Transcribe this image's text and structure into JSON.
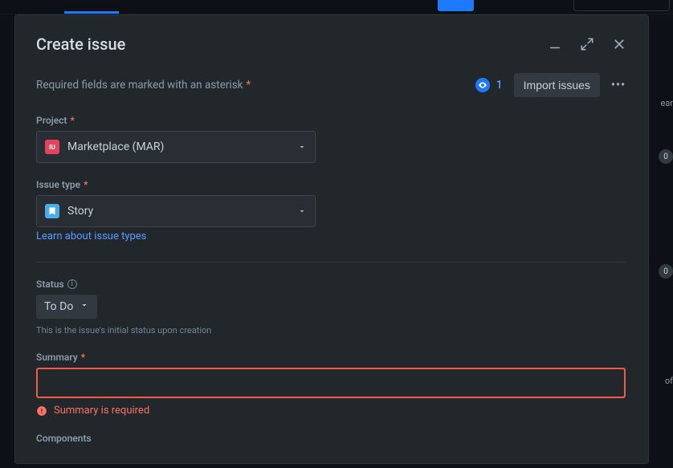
{
  "title": "Create issue",
  "required_hint": "Required fields are marked with an asterisk",
  "watch_count": "1",
  "import_btn": "Import issues",
  "project": {
    "label": "Project",
    "value": "Marketplace (MAR)"
  },
  "issue_type": {
    "label": "Issue type",
    "value": "Story",
    "learn_link": "Learn about issue types"
  },
  "status": {
    "label": "Status",
    "value": "To Do",
    "help": "This is the issue's initial status upon creation"
  },
  "summary": {
    "label": "Summary",
    "value": "",
    "error": "Summary is required"
  },
  "components": {
    "label": "Components"
  },
  "bg": {
    "side_label": "ear",
    "badge1": "0",
    "badge2": "0",
    "side_txt": "of"
  }
}
